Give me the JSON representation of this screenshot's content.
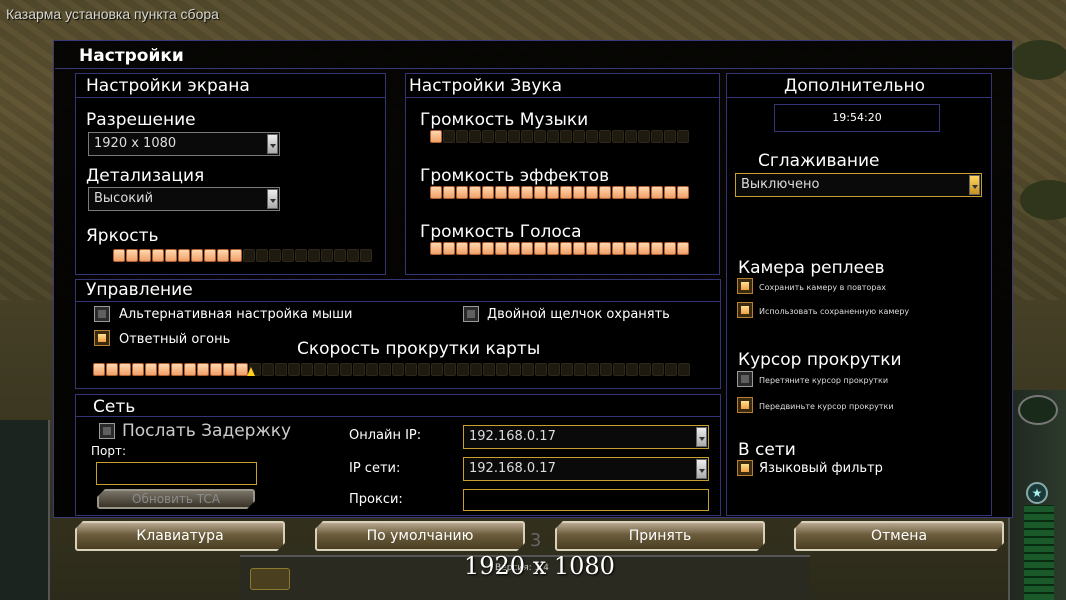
{
  "window": {
    "title": "Казарма установка пункта сбора"
  },
  "dialog": {
    "title": "Настройки"
  },
  "screen": {
    "title": "Настройки экрана",
    "resolution_label": "Разрешение",
    "resolution_value": "1920 x 1080",
    "detail_label": "Детализация",
    "detail_value": "Высокий",
    "brightness_label": "Яркость",
    "brightness_level": 0.5
  },
  "sound": {
    "title": "Настройки Звука",
    "music_label": "Громкость Музыки",
    "music_level": 0.05,
    "effects_label": "Громкость эффектов",
    "effects_level": 1.0,
    "voice_label": "Громкость Голоса",
    "voice_level": 1.0
  },
  "extra": {
    "title": "Дополнительно",
    "clock": "19:54:20",
    "antialias_label": "Сглаживание",
    "antialias_value": "Выключено",
    "replay_camera_title": "Камера реплеев",
    "replay_opt1": "Сохранить камеру в повторах",
    "replay_opt1_checked": true,
    "replay_opt2": "Использовать сохраненную камеру",
    "replay_opt2_checked": true,
    "scroll_cursor_title": "Курсор прокрутки",
    "scroll_opt1": "Перетяните курсор прокрутки",
    "scroll_opt1_checked": false,
    "scroll_opt2": "Передвиньте курсор прокрутки",
    "scroll_opt2_checked": true,
    "online_title": "В сети",
    "lang_filter": "Языковый фильтр",
    "lang_filter_checked": true
  },
  "control": {
    "title": "Управление",
    "alt_mouse": "Альтернативная настройка мыши",
    "alt_mouse_checked": false,
    "double_click": "Двойной щелчок охранять",
    "double_click_checked": false,
    "return_fire": "Ответный огонь",
    "return_fire_checked": true,
    "scroll_speed_label": "Скорость прокрутки карты",
    "scroll_speed_level": 0.27
  },
  "network": {
    "title": "Сеть",
    "send_delay": "Послать Задержку",
    "send_delay_checked": false,
    "port_label": "Порт:",
    "port_value": "",
    "update_tca": "Обновить TCA",
    "online_ip_label": "Онлайн IP:",
    "online_ip_value": "192.168.0.17",
    "lan_ip_label": "IP сети:",
    "lan_ip_value": "192.168.0.17",
    "proxy_label": "Прокси:",
    "proxy_value": ""
  },
  "buttons": {
    "keyboard": "Клавиатура",
    "defaults": "По умолчанию",
    "accept": "Принять",
    "cancel": "Отмена"
  },
  "caption": "1920 x 1080",
  "colors": {
    "panel_border": "#353575",
    "accent_gold": "#c8a030",
    "slider_on": "#f0a068"
  }
}
